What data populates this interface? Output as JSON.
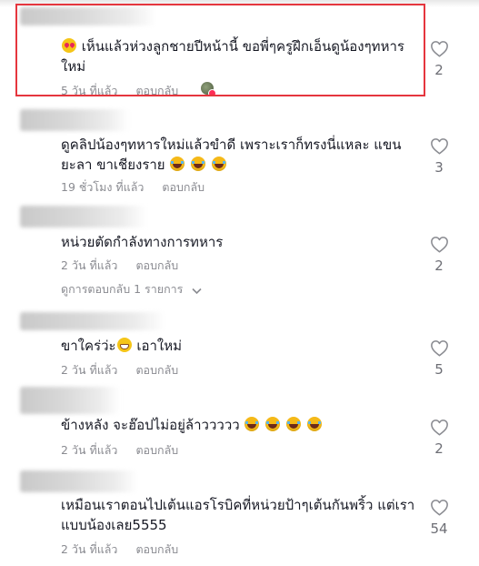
{
  "comments": [
    {
      "text_suffix": "เห็นแล้วห่วงลูกชายปีหน้านี้ ขอพี่ๆครูฝึกเอ็นดูน้องๆทหารใหม่",
      "time": "5 วัน ที่แล้ว",
      "reply": "ตอบกลับ",
      "likes": "2",
      "highlighted": true
    },
    {
      "text": "ดูคลิปน้องๆทหารใหม่แล้วขำดี เพราะเราก็ทรงนี่แหละ แขนยะลา ขาเชียงราย",
      "time": "19 ชั่วโมง ที่แล้ว",
      "reply": "ตอบกลับ",
      "likes": "3"
    },
    {
      "text": "หน่วยตัดกำลังทางการทหาร",
      "time": "2 วัน ที่แล้ว",
      "reply": "ตอบกลับ",
      "likes": "2",
      "view_replies": "ดูการตอบกลับ 1 รายการ"
    },
    {
      "text_prefix": "ขาใคร่ว่ะ",
      "text_suffix": " เอาใหม่",
      "time": "2 วัน ที่แล้ว",
      "reply": "ตอบกลับ",
      "likes": "5"
    },
    {
      "text": "ข้างหลัง จะฮ๊อปไม่อยู่ล้าววววว",
      "time": "2 วัน ที่แล้ว",
      "reply": "ตอบกลับ",
      "likes": "2"
    },
    {
      "text": "เหมือนเราตอนไปเต้นแอรโรบิคที่หน่วยป้าๆเต้นกันพริ้ว แต่เราแบบน้องเลย5555",
      "time": "2 วัน ที่แล้ว",
      "reply": "ตอบกลับ",
      "likes": "54"
    }
  ],
  "icons": {
    "like": "heart-outline-icon",
    "chevron": "chevron-down-icon"
  },
  "colors": {
    "highlight_border": "#e5363e",
    "meta_text": "#8a8b91",
    "heart_stroke": "#8a8b91"
  }
}
